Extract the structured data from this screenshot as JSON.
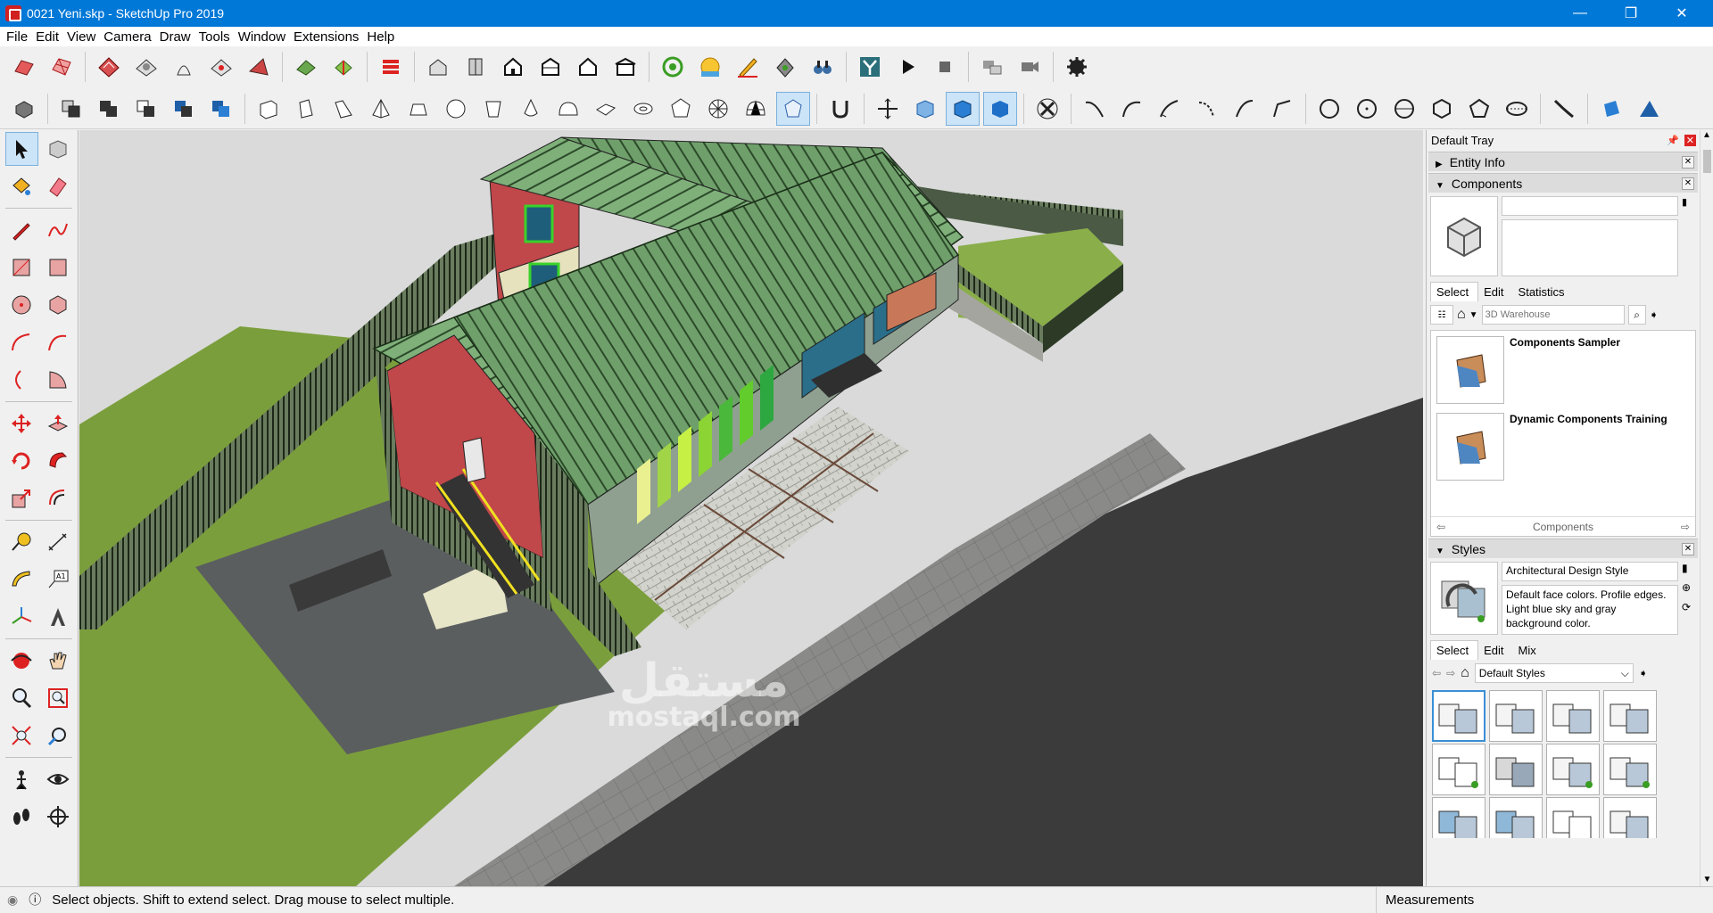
{
  "window": {
    "title": "0021 Yeni.skp - SketchUp Pro 2019",
    "minimize": "—",
    "maximize": "❐",
    "close": "✕"
  },
  "menu": [
    "File",
    "Edit",
    "View",
    "Camera",
    "Draw",
    "Tools",
    "Window",
    "Extensions",
    "Help"
  ],
  "tray": {
    "title": "Default Tray",
    "pin": "📌",
    "close": "✕",
    "entity_info": {
      "label": "Entity Info"
    },
    "components": {
      "label": "Components",
      "tabs": [
        "Select",
        "Edit",
        "Statistics"
      ],
      "search_placeholder": "3D Warehouse",
      "items": [
        {
          "name": "Components Sampler"
        },
        {
          "name": "Dynamic Components Training"
        }
      ],
      "footer_label": "Components"
    },
    "styles": {
      "label": "Styles",
      "style_name": "Architectural Design Style",
      "description": "Default face colors. Profile edges. Light blue sky and gray background color.",
      "tabs": [
        "Select",
        "Edit",
        "Mix"
      ],
      "library": "Default Styles"
    }
  },
  "status": {
    "message": "Select objects. Shift to extend select. Drag mouse to select multiple.",
    "measurements_label": "Measurements"
  },
  "watermark": {
    "arabic": "مستقل",
    "latin": "mostaql.com"
  },
  "colors": {
    "titlebar": "#0078d7",
    "roof": "#7fb07a",
    "wall": "#c0474a",
    "grass": "#7b9e3c",
    "road": "#3c3c3c"
  }
}
